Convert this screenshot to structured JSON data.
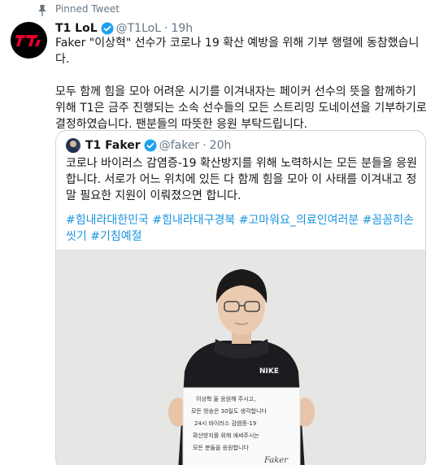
{
  "pinned": {
    "label": "Pinned Tweet",
    "icon": "pin-icon"
  },
  "tweet": {
    "display_name": "T1 LoL",
    "handle": "@T1LoL",
    "separator": "·",
    "time": "19h",
    "paragraphs": [
      "Faker \"이상혁\" 선수가 코로나 19 확산 예방을 위해 기부 행렬에 동참했습니다.",
      "모두 함께 힘을 모아 어려운 시기를 이겨내자는 페이커 선수의 뜻을 함께하기 위해 T1은 금주 진행되는 소속 선수들의 모든 스트리밍 도네이션을 기부하기로 결정하였습니다. 팬분들의 따뜻한 응원 부탁드립니다."
    ]
  },
  "quoted": {
    "display_name": "T1 Faker",
    "handle": "@faker",
    "separator": "·",
    "time": "20h",
    "paragraphs": [
      "코로나 바이러스 감염증-19 확산방지를 위해 노력하시는 모든 분들을 응원합니다. 서로가 어느 위치에 있든 다 함께 힘을 모아 이 사태를 이겨내고 정말 필요한 지원이 이뤄졌으면 합니다.",
      "#힘내라대한민국 #힘내라대구경북 #고마워요_의료인여러분 #꼼꼼히손씻기 #기침예절"
    ],
    "hashtag_color": "#1b95e0"
  },
  "photo": {
    "sweater_logo": "NIKE",
    "sign_lines": [
      "이상혁 올 응원해 주시고,",
      "모든 방송은 30일도 생각합니다",
      "24시 바이러스 감염증-19",
      "확산방지를 위해 애써주시는",
      "모든 분들을 응원합니다"
    ],
    "sign_signature": "Faker"
  },
  "colors": {
    "text": "#14171a",
    "secondary": "#657786",
    "verified": "#1da1f2",
    "border": "#ccd6dd",
    "brand_red": "#e2012d"
  }
}
